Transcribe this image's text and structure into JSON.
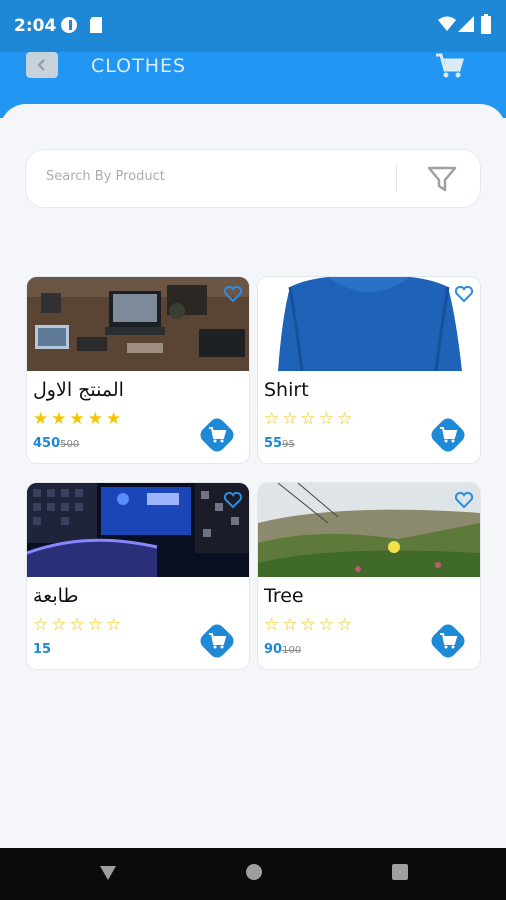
{
  "status": {
    "time": "2:04"
  },
  "header": {
    "title": "CLOTHES",
    "back_icon": "chevron-left-icon",
    "cart_icon": "cart-icon"
  },
  "search": {
    "placeholder": "Search By Product",
    "filter_icon": "filter-icon"
  },
  "colors": {
    "primary": "#2196f3",
    "star": "#f5c400",
    "price": "#1e88d6"
  },
  "products": [
    {
      "name": "المنتج الاول",
      "rating": 5,
      "price": "450",
      "old_price": "500"
    },
    {
      "name": "Shirt",
      "rating": 0,
      "price": "55",
      "old_price": "95"
    },
    {
      "name": "طابعة",
      "rating": 0,
      "price": "15",
      "old_price": ""
    },
    {
      "name": "Tree",
      "rating": 0,
      "price": "90",
      "old_price": "100"
    }
  ]
}
